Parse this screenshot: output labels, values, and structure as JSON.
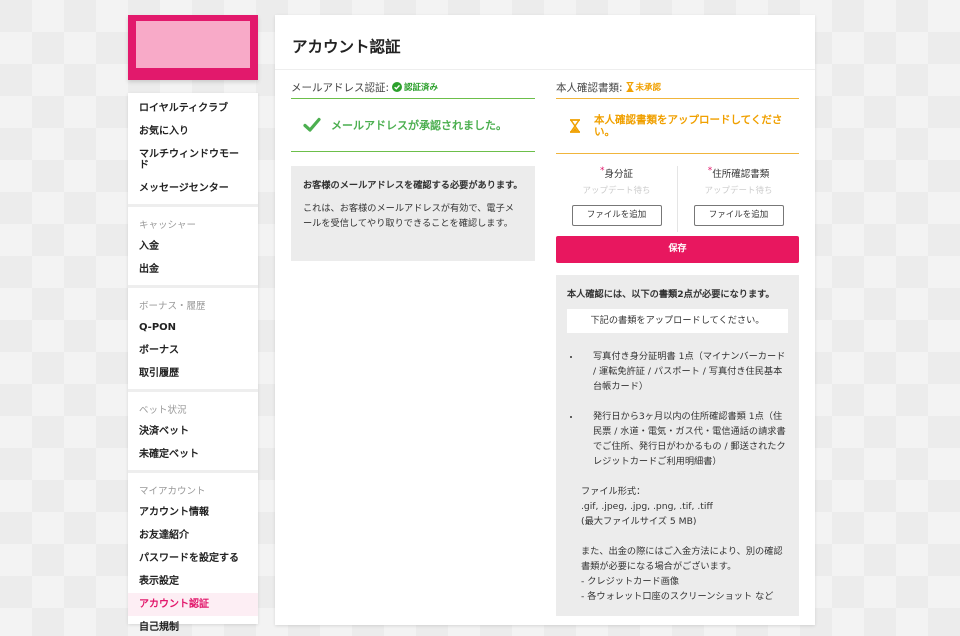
{
  "sidebar": {
    "groups": [
      {
        "heading": null,
        "items": [
          "ロイヤルティクラブ",
          "お気に入り",
          "マルチウィンドウモード",
          "メッセージセンター"
        ]
      },
      {
        "heading": "キャッシャー",
        "items": [
          "入金",
          "出金"
        ]
      },
      {
        "heading": "ボーナス・履歴",
        "items": [
          "Q-PON",
          "ボーナス",
          "取引履歴"
        ]
      },
      {
        "heading": "ベット状況",
        "items": [
          "決済ベット",
          "未確定ベット"
        ]
      },
      {
        "heading": "マイアカウント",
        "items": [
          "アカウント情報",
          "お友達紹介",
          "パスワードを設定する",
          "表示設定",
          "アカウント認証",
          "自己規制"
        ]
      }
    ],
    "active_item": "アカウント認証"
  },
  "page": {
    "title": "アカウント認証"
  },
  "email_section": {
    "label": "メールアドレス認証:",
    "badge": "認証済み",
    "verified_message": "メールアドレスが承認されました。",
    "info_title": "お客様のメールアドレスを確認する必要があります。",
    "info_body": "これは、お客様のメールアドレスが有効で、電子メールを受信してやり取りできることを確認します。"
  },
  "id_section": {
    "label": "本人確認書類:",
    "badge": "未承認",
    "pending_message": "本人確認書類をアップロードしてください。",
    "uploads": [
      {
        "label": "身分証",
        "status": "アップデート待ち",
        "button": "ファイルを追加"
      },
      {
        "label": "住所確認書類",
        "status": "アップデート待ち",
        "button": "ファイルを追加"
      }
    ],
    "save_label": "保存",
    "requirements": {
      "intro": "本人確認には、以下の書類2点が必要になります。",
      "notice": "下記の書類をアップロードしてください。",
      "items": [
        "写真付き身分証明書 1点（マイナンバーカード / 運転免許証 / パスポート / 写真付き住民基本台帳カード）",
        "発行日から3ヶ月以内の住所確認書類 1点（住民票 / 水道・電気・ガス代・電信通話の請求書でご住所、発行日がわかるもの / 郵送されたクレジットカードご利用明細書）"
      ],
      "format_label": "ファイル形式：",
      "format_list": ".gif, .jpeg, .jpg, .png, .tif, .tiff",
      "format_size": "(最大ファイルサイズ 5 MB)",
      "note": "また、出金の際にはご入金方法により、別の確認書類が必要になる場合がございます。",
      "note_items": [
        "- クレジットカード画像",
        "- 各ウォレット口座のスクリーンショット など"
      ]
    }
  },
  "colors": {
    "brand": "#e2196c",
    "success": "#4caf50",
    "pending": "#f0a000"
  }
}
